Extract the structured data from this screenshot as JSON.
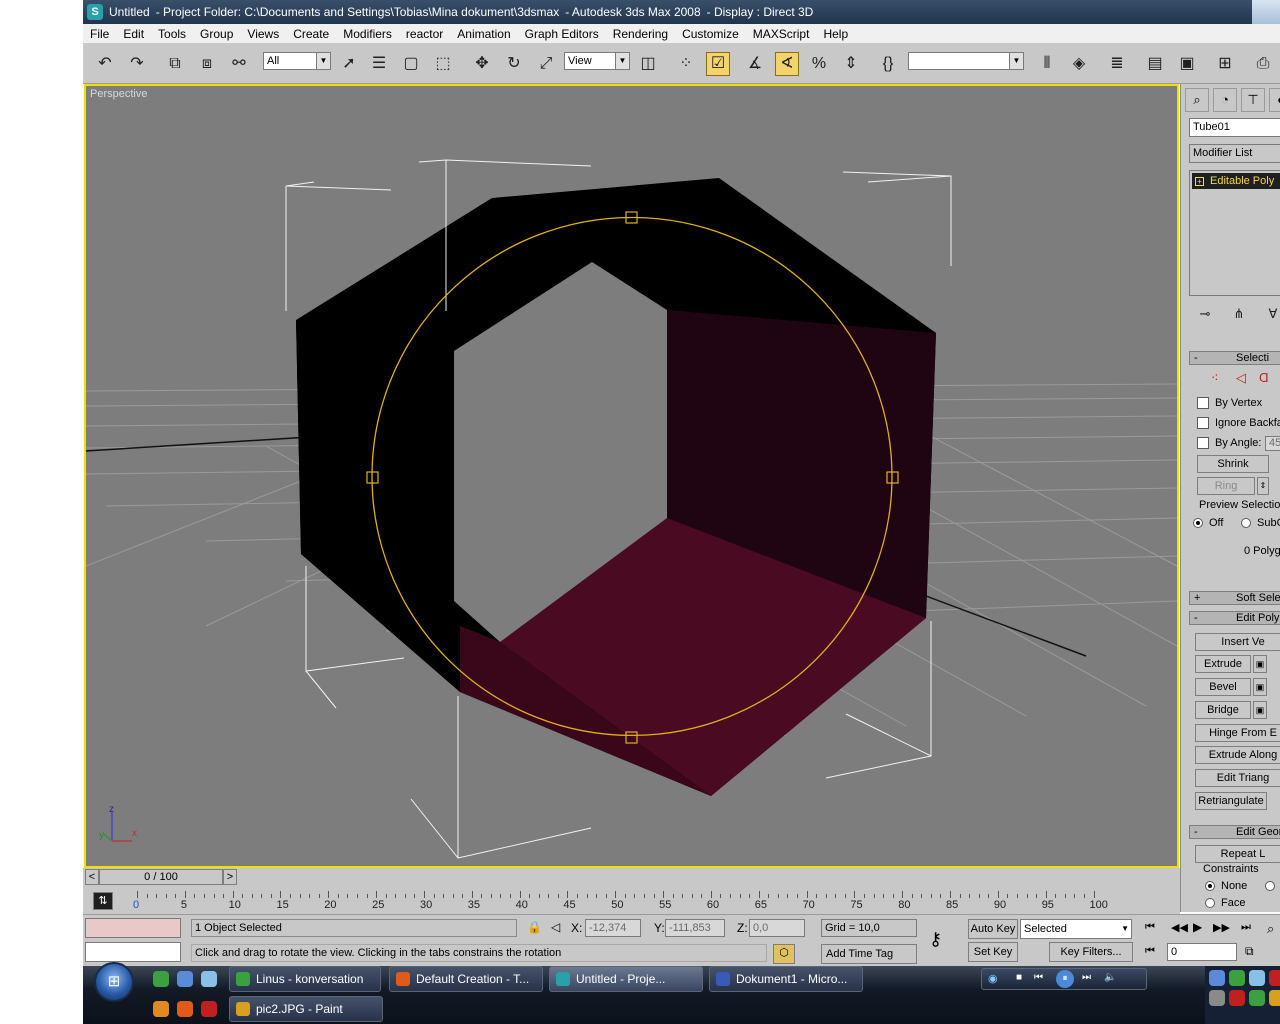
{
  "window": {
    "title_app": "Untitled",
    "title_project": "- Project Folder: C:\\Documents and Settings\\Tobias\\Mina dokument\\3dsmax",
    "title_product": "- Autodesk 3ds Max 2008",
    "title_display": "- Display : Direct 3D"
  },
  "menu": [
    "File",
    "Edit",
    "Tools",
    "Group",
    "Views",
    "Create",
    "Modifiers",
    "reactor",
    "Animation",
    "Graph Editors",
    "Rendering",
    "Customize",
    "MAXScript",
    "Help"
  ],
  "toolbar": {
    "selection_filter": "All",
    "reference_coord": "View",
    "named_selection": ""
  },
  "viewport": {
    "label": "Perspective",
    "axis_x": "x",
    "axis_y": "y",
    "axis_z": "z"
  },
  "command_panel": {
    "object_name": "Tube01",
    "modifier_list": "Modifier List",
    "stack_item": "Editable Poly",
    "selection_rollout": "Selecti",
    "by_vertex": "By Vertex",
    "ignore_backfacing": "Ignore Backfa",
    "by_angle": "By Angle:",
    "by_angle_value": "45",
    "shrink": "Shrink",
    "ring": "Ring",
    "preview_selection": "Preview Selection",
    "preview_off": "Off",
    "preview_subobj": "SubO",
    "polygons_selected": "0 Polyg",
    "soft_selection": "Soft Sele",
    "edit_polygons": "Edit Poly",
    "insert_vertex": "Insert Ve",
    "extrude": "Extrude",
    "bevel": "Bevel",
    "bridge": "Bridge",
    "hinge_from_edge": "Hinge From E",
    "extrude_along_spline": "Extrude Along",
    "edit_triangulation": "Edit Triang",
    "retriangulate": "Retriangulate",
    "edit_geometry": "Edit Geon",
    "repeat_last": "Repeat L",
    "constraints": "Constraints",
    "constraint_none": "None",
    "constraint_face": "Face"
  },
  "timeline": {
    "slider": "0 / 100",
    "ticks": [
      "0",
      "5",
      "10",
      "15",
      "20",
      "25",
      "30",
      "35",
      "40",
      "45",
      "50",
      "55",
      "60",
      "65",
      "70",
      "75",
      "80",
      "85",
      "90",
      "95",
      "100"
    ]
  },
  "status": {
    "selection": "1 Object Selected",
    "prompt": "Click and drag to rotate the view.  Clicking in the tabs constrains the rotation",
    "x_label": "X:",
    "x_value": "-12,374",
    "y_label": "Y:",
    "y_value": "-111,853",
    "z_label": "Z:",
    "z_value": "0,0",
    "grid": "Grid = 10,0",
    "add_time_tag": "Add Time Tag",
    "auto_key": "Auto Key",
    "set_key": "Set Key",
    "key_mode": "Selected",
    "key_filters": "Key Filters...",
    "current_frame": "0"
  },
  "taskbar": {
    "tasks_top": [
      "Linus - konversation",
      "Default Creation - T...",
      "Untitled      - Proje...",
      "Dokument1 - Micro..."
    ],
    "tasks_bottom": [
      "pic2.JPG - Paint"
    ]
  },
  "colors": {
    "accent_yellow": "#f0e000",
    "tube_face": "#4a0a22",
    "viewport_bg": "#7d7d7d",
    "ui_gray": "#c8c8c8"
  }
}
